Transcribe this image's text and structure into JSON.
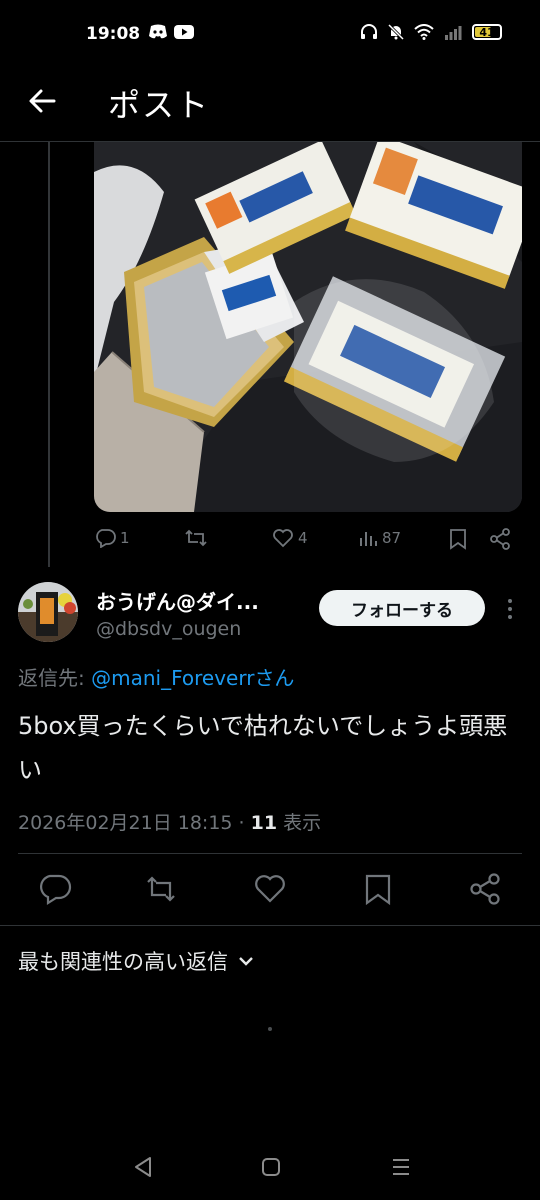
{
  "status_bar": {
    "time": "19:08",
    "battery": "41",
    "icons_left": [
      "discord-icon",
      "youtube-icon"
    ],
    "icons_right": [
      "headphones-icon",
      "mute-icon",
      "wifi-icon",
      "signal-icon",
      "battery-icon"
    ]
  },
  "header": {
    "title": "ポスト",
    "back_icon": "arrow-left-icon"
  },
  "parent_post": {
    "media_alt_icon": "photo",
    "actions": {
      "replies": "1",
      "retweets": "",
      "likes": "4",
      "views": "87"
    }
  },
  "reply": {
    "display_name": "おうげん@ダイ...",
    "handle": "@dbsdv_ougen",
    "follow_label": "フォローする",
    "reply_to_prefix": "返信先: ",
    "reply_to_mention": "@mani_Foreverr",
    "reply_to_suffix": "さん",
    "text": "5box買ったくらいで枯れないでしょうよ頭悪い",
    "timestamp": "2026年02月21日 18:15 · ",
    "view_count": "11",
    "view_label": " 表示"
  },
  "sort": {
    "label": "最も関連性の高い返信"
  },
  "colors": {
    "background": "#000000",
    "text": "#e7e9ea",
    "muted": "#71767b",
    "accent": "#1d9bf0",
    "follow_bg": "#eff3f4"
  }
}
